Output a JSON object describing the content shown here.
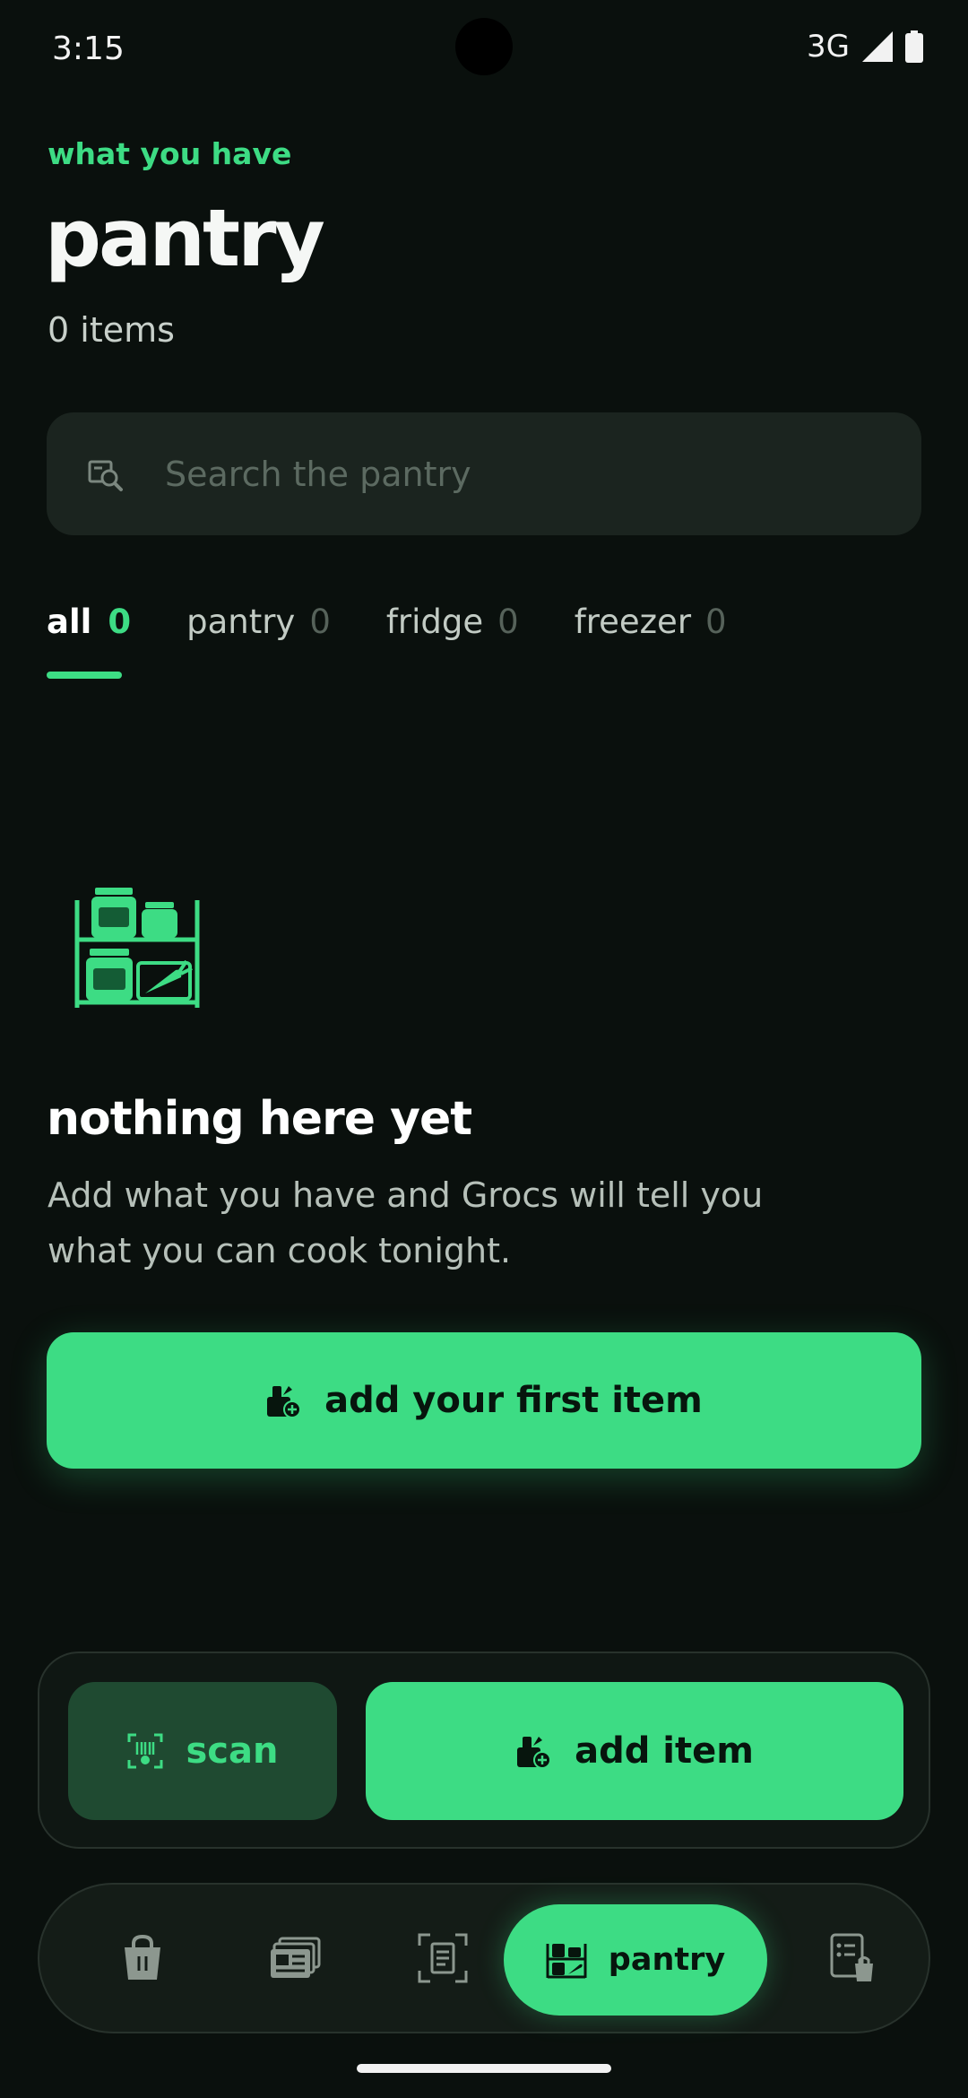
{
  "status_bar": {
    "time": "3:15",
    "network": "3G"
  },
  "header": {
    "eyebrow": "what you have",
    "title": "pantry",
    "count": "0 items"
  },
  "search": {
    "placeholder": "Search the pantry",
    "value": ""
  },
  "tabs": [
    {
      "label": "all",
      "count": "0",
      "active": true
    },
    {
      "label": "pantry",
      "count": "0",
      "active": false
    },
    {
      "label": "fridge",
      "count": "0",
      "active": false
    },
    {
      "label": "freezer",
      "count": "0",
      "active": false
    }
  ],
  "empty_state": {
    "title": "nothing here yet",
    "description": "Add what you have and Grocs will tell you what you can cook tonight.",
    "button_label": "add your first item"
  },
  "actions": {
    "scan_label": "scan",
    "add_label": "add item"
  },
  "bottom_nav": {
    "items": [
      {
        "icon": "shopping-bag-icon"
      },
      {
        "icon": "recipes-cards-icon"
      },
      {
        "icon": "scan-receipt-icon"
      },
      {
        "icon": "pantry-icon",
        "label": "pantry",
        "active": true
      },
      {
        "icon": "shopping-list-icon"
      }
    ]
  },
  "colors": {
    "accent": "#3ddc84",
    "background": "#0a100d",
    "surface": "#1b241f"
  }
}
